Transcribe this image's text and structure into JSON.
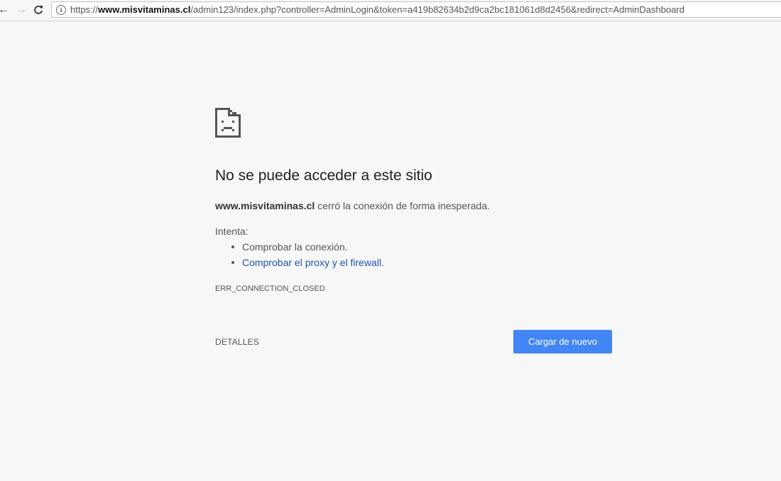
{
  "browser": {
    "url_scheme": "https://",
    "url_host": "www.misvitaminas.cl",
    "url_path": "/admin123/index.php?controller=AdminLogin&token=a419b82634b2d9ca2bc181061d8d2456&redirect=AdminDashboard",
    "back_icon": "arrow-left-icon",
    "forward_icon": "arrow-right-icon",
    "reload_icon": "reload-icon",
    "info_icon": "info-icon"
  },
  "error_page": {
    "icon": "sad-page-icon",
    "heading": "No se puede acceder a este sitio",
    "summary_host": "www.misvitaminas.cl",
    "summary_text": " cerró la conexión de forma inesperada.",
    "try_label": "Intenta:",
    "suggestions": [
      "Comprobar la conexión.",
      "Comprobar el proxy y el firewall."
    ],
    "error_code": "ERR_CONNECTION_CLOSED",
    "details_label": "DETALLES",
    "reload_label": "Cargar de nuevo"
  },
  "colors": {
    "background": "#f7f7f7",
    "button_blue": "#4285f4",
    "link_blue": "#1d52b5"
  }
}
